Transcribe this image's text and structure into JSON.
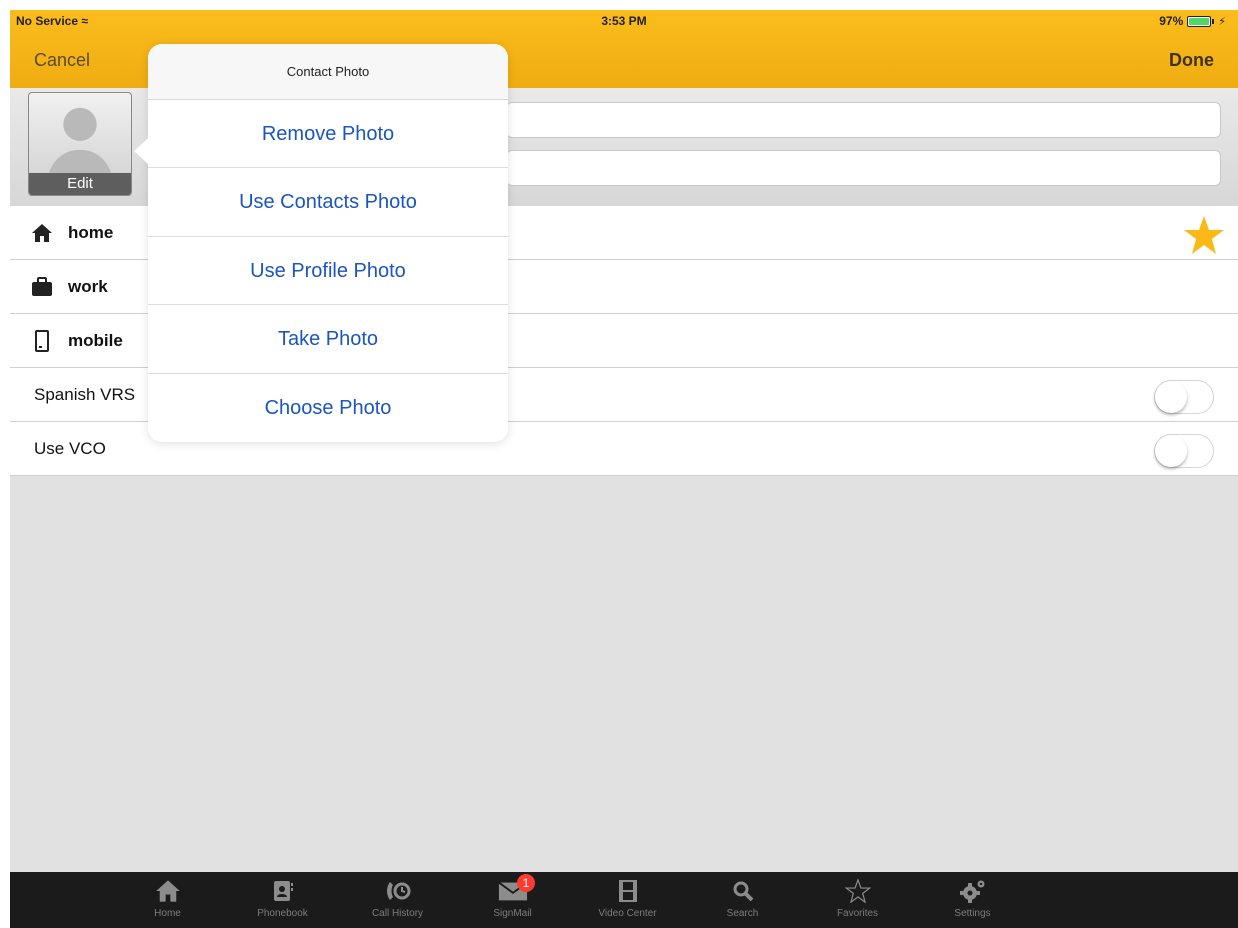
{
  "status_bar": {
    "carrier": "No Service",
    "time": "3:53 PM",
    "battery": "97%"
  },
  "nav": {
    "cancel": "Cancel",
    "done": "Done"
  },
  "photo": {
    "edit_label": "Edit"
  },
  "rows": [
    {
      "label": "home",
      "icon": "home-icon"
    },
    {
      "label": "work",
      "icon": "briefcase-icon"
    },
    {
      "label": "mobile",
      "icon": "mobile-phone-icon"
    },
    {
      "label": "Spanish VRS",
      "toggle": false
    },
    {
      "label": "Use VCO",
      "toggle": false
    }
  ],
  "popover": {
    "title": "Contact Photo",
    "items": [
      "Remove Photo",
      "Use Contacts Photo",
      "Use Profile Photo",
      "Take Photo",
      "Choose Photo"
    ]
  },
  "tabbar": {
    "items": [
      {
        "label": "Home",
        "icon": "home-icon"
      },
      {
        "label": "Phonebook",
        "icon": "phonebook-icon"
      },
      {
        "label": "Call History",
        "icon": "call-history-icon"
      },
      {
        "label": "SignMail",
        "icon": "envelope-icon",
        "badge": "1"
      },
      {
        "label": "Video Center",
        "icon": "film-icon"
      },
      {
        "label": "Search",
        "icon": "search-icon"
      },
      {
        "label": "Favorites",
        "icon": "star-outline-icon"
      },
      {
        "label": "Settings",
        "icon": "gear-icon"
      }
    ]
  },
  "colors": {
    "nav_bar": "#fbbd1c",
    "link_blue": "#1c55c0",
    "favorite_star": "#fbb917",
    "badge": "#ff3b30"
  }
}
